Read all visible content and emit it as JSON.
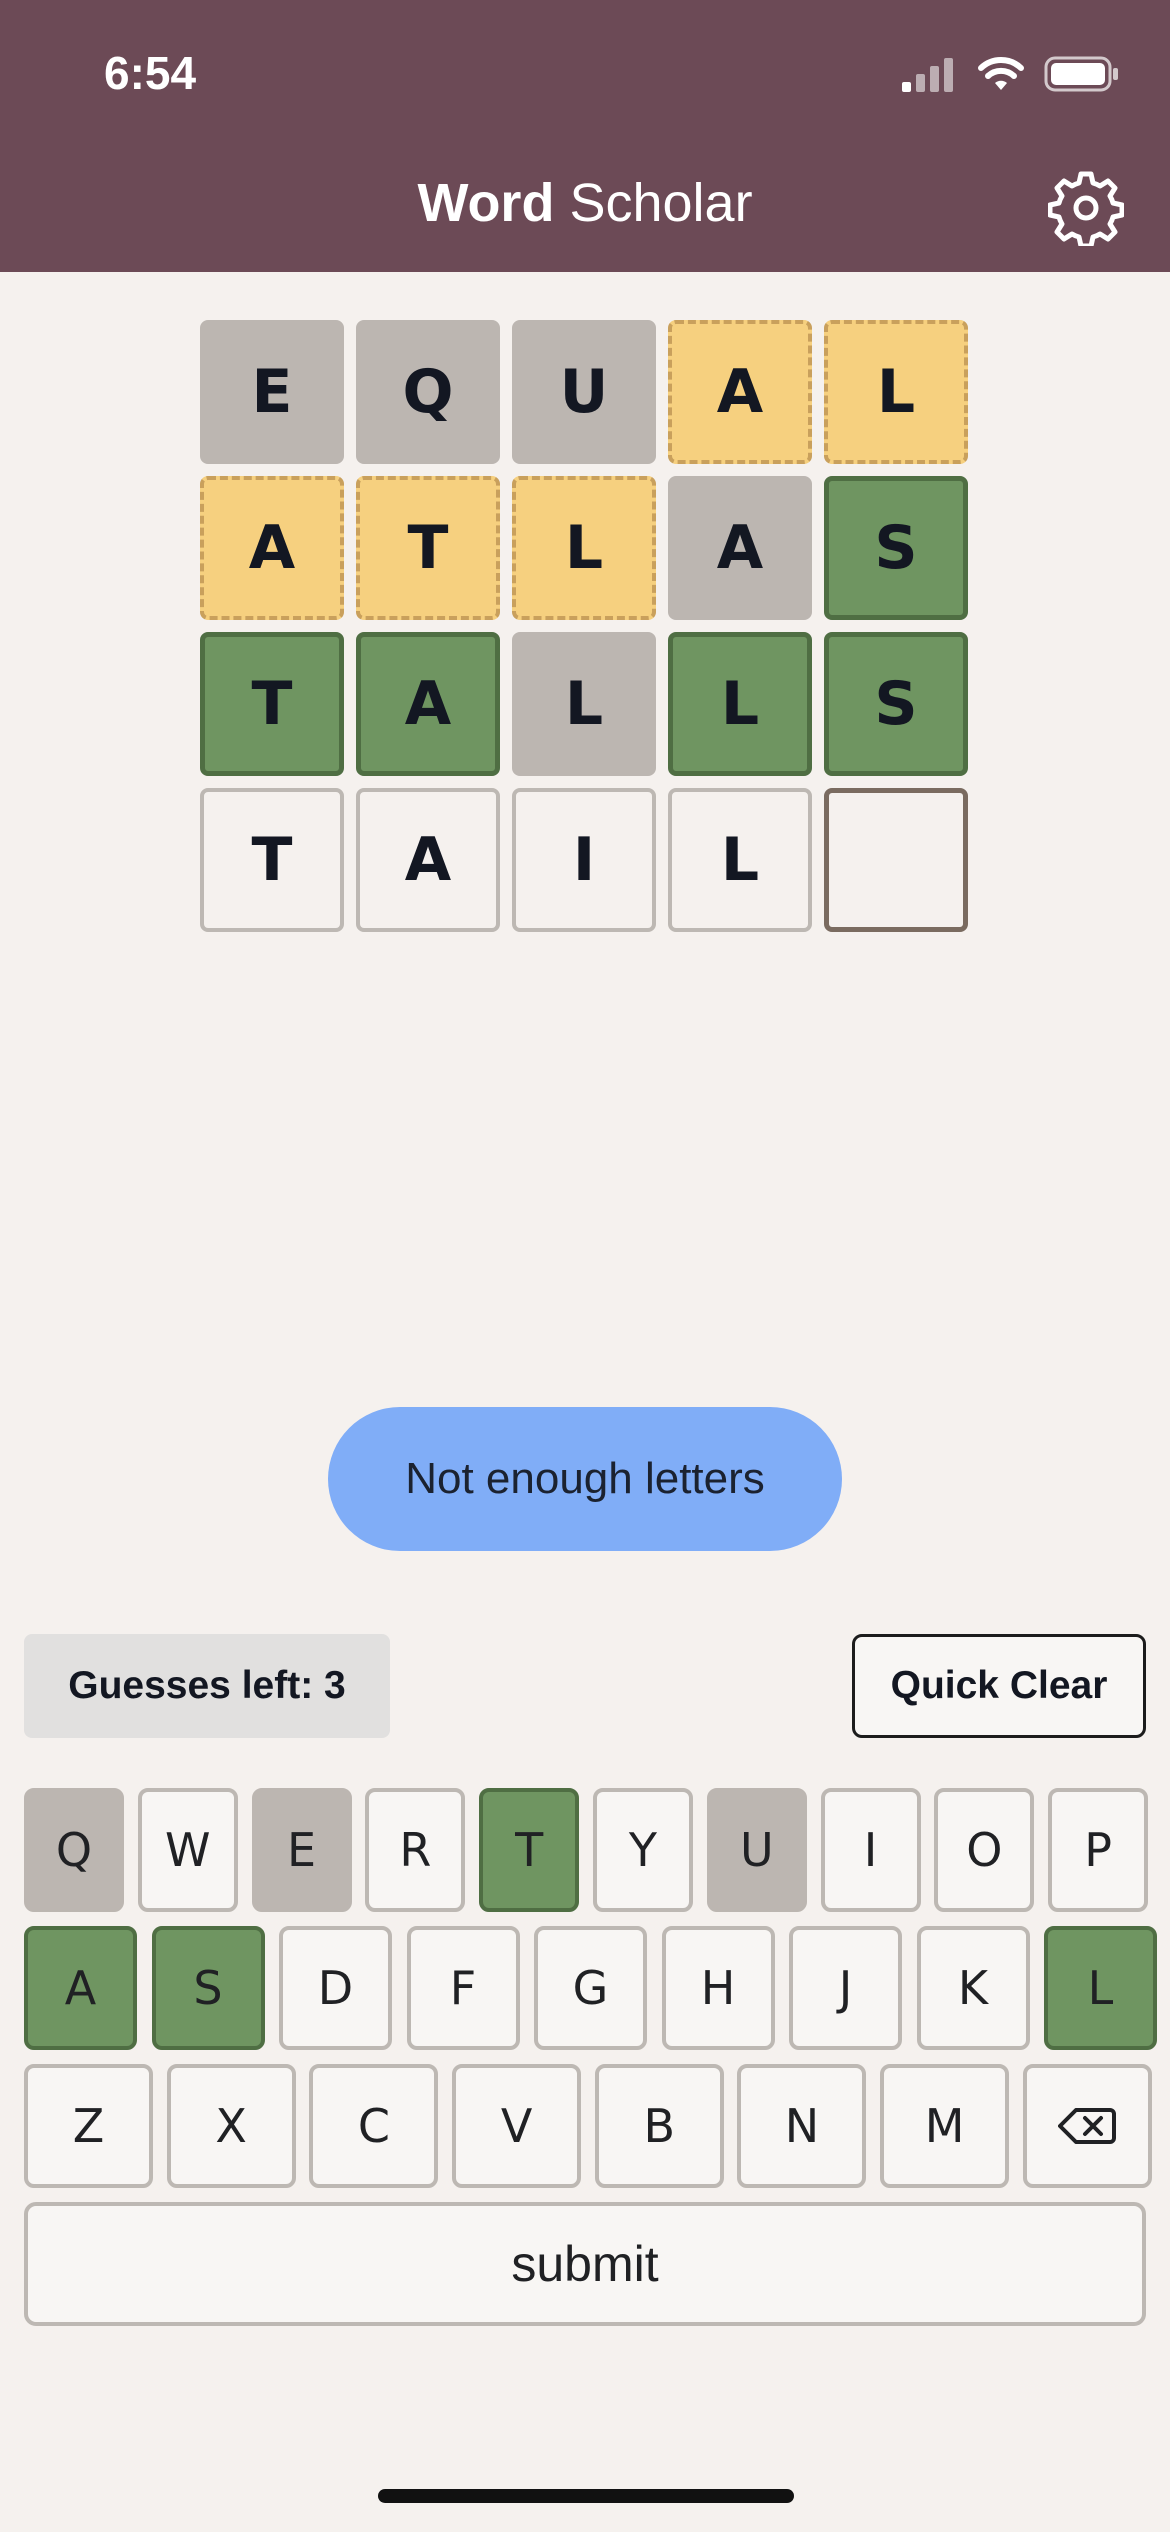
{
  "status_bar": {
    "time": "6:54"
  },
  "header": {
    "title_bold": "Word",
    "title_light": "Scholar",
    "settings_icon": "gear-icon"
  },
  "board": {
    "rows": [
      [
        {
          "letter": "E",
          "state": "absent"
        },
        {
          "letter": "Q",
          "state": "absent"
        },
        {
          "letter": "U",
          "state": "absent"
        },
        {
          "letter": "A",
          "state": "present"
        },
        {
          "letter": "L",
          "state": "present"
        }
      ],
      [
        {
          "letter": "A",
          "state": "present"
        },
        {
          "letter": "T",
          "state": "present"
        },
        {
          "letter": "L",
          "state": "present"
        },
        {
          "letter": "A",
          "state": "absent"
        },
        {
          "letter": "S",
          "state": "correct"
        }
      ],
      [
        {
          "letter": "T",
          "state": "correct"
        },
        {
          "letter": "A",
          "state": "correct"
        },
        {
          "letter": "L",
          "state": "absent"
        },
        {
          "letter": "L",
          "state": "correct"
        },
        {
          "letter": "S",
          "state": "correct"
        }
      ],
      [
        {
          "letter": "T",
          "state": "empty"
        },
        {
          "letter": "A",
          "state": "empty"
        },
        {
          "letter": "I",
          "state": "empty"
        },
        {
          "letter": "L",
          "state": "empty"
        },
        {
          "letter": "",
          "state": "active"
        }
      ]
    ]
  },
  "toast": {
    "message": "Not enough letters"
  },
  "controls": {
    "guesses_left": "Guesses left: 3",
    "quick_clear": "Quick Clear"
  },
  "keyboard": {
    "rows": [
      [
        {
          "key": "Q",
          "state": "absent"
        },
        {
          "key": "W",
          "state": "unused"
        },
        {
          "key": "E",
          "state": "absent"
        },
        {
          "key": "R",
          "state": "unused"
        },
        {
          "key": "T",
          "state": "correct"
        },
        {
          "key": "Y",
          "state": "unused"
        },
        {
          "key": "U",
          "state": "absent"
        },
        {
          "key": "I",
          "state": "unused"
        },
        {
          "key": "O",
          "state": "unused"
        },
        {
          "key": "P",
          "state": "unused"
        }
      ],
      [
        {
          "key": "A",
          "state": "correct"
        },
        {
          "key": "S",
          "state": "correct"
        },
        {
          "key": "D",
          "state": "unused"
        },
        {
          "key": "F",
          "state": "unused"
        },
        {
          "key": "G",
          "state": "unused"
        },
        {
          "key": "H",
          "state": "unused"
        },
        {
          "key": "J",
          "state": "unused"
        },
        {
          "key": "K",
          "state": "unused"
        },
        {
          "key": "L",
          "state": "correct"
        }
      ],
      [
        {
          "key": "Z",
          "state": "unused"
        },
        {
          "key": "X",
          "state": "unused"
        },
        {
          "key": "C",
          "state": "unused"
        },
        {
          "key": "V",
          "state": "unused"
        },
        {
          "key": "B",
          "state": "unused"
        },
        {
          "key": "N",
          "state": "unused"
        },
        {
          "key": "M",
          "state": "unused"
        },
        {
          "key": "",
          "state": "unused",
          "icon": "backspace-icon"
        }
      ]
    ],
    "submit_label": "submit"
  },
  "colors": {
    "header_bg": "#6c4a56",
    "page_bg": "#f5f1ee",
    "absent": "#bcb6b1",
    "present": "#f6d07f",
    "correct": "#6f9561",
    "toast": "#80adf7"
  }
}
